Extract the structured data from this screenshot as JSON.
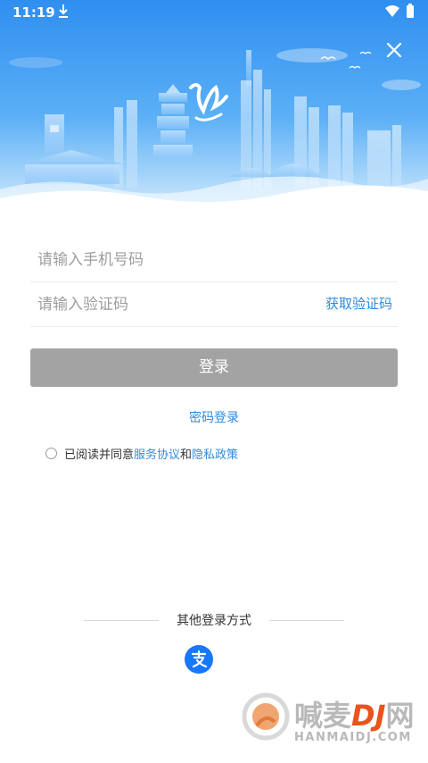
{
  "status_bar": {
    "time": "11:19",
    "icons": [
      "download-icon",
      "wifi-icon",
      "battery-icon"
    ]
  },
  "header": {
    "close_icon": "close-icon",
    "logo_alt": "城市插画 logo"
  },
  "form": {
    "phone_placeholder": "请输入手机号码",
    "code_placeholder": "请输入验证码",
    "get_code_label": "获取验证码",
    "login_label": "登录",
    "password_login_label": "密码登录"
  },
  "agreement": {
    "prefix": "已阅读并同意",
    "service_link": "服务协议",
    "and": "和",
    "privacy_link": "隐私政策"
  },
  "other_login": {
    "label": "其他登录方式",
    "alipay_icon": "alipay-icon"
  },
  "watermark": {
    "text": "喊麦",
    "dj": "DJ",
    "suffix": "网",
    "sub": "HANMAIDJ.COM"
  },
  "colors": {
    "accent": "#2d8be0",
    "button_disabled": "#a3a3a3",
    "header_sky": "#3a9cf0"
  }
}
